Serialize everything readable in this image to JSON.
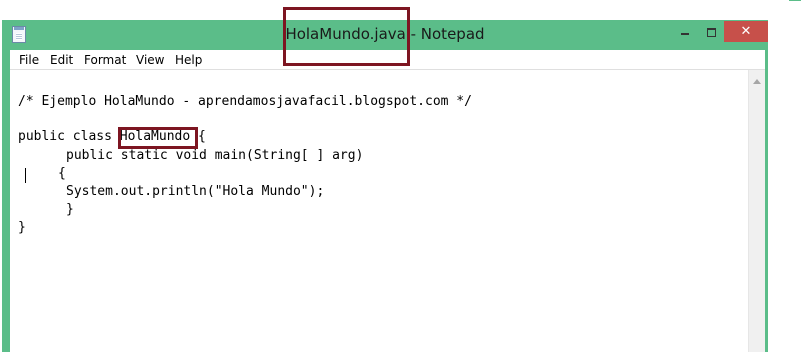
{
  "window": {
    "title": "HolaMundo.java - Notepad",
    "close_label": "✕",
    "colors": {
      "titlebar": "#5bbd89",
      "close": "#c7504a",
      "highlight": "#7d1521"
    }
  },
  "menu": [
    {
      "label": "File"
    },
    {
      "label": "Edit"
    },
    {
      "label": "Format"
    },
    {
      "label": "View"
    },
    {
      "label": "Help"
    }
  ],
  "editor": {
    "lines": [
      "/* Ejemplo HolaMundo - aprendamosjavafacil.blogspot.com */",
      "public class HolaMundo {",
      "public static void main(String[ ] arg)",
      "{",
      "System.out.println(\"Hola Mundo\");",
      "}",
      "}"
    ]
  },
  "icons": [
    "notepad-icon",
    "minimize-icon",
    "maximize-icon",
    "close-icon",
    "scroll-up-icon"
  ]
}
